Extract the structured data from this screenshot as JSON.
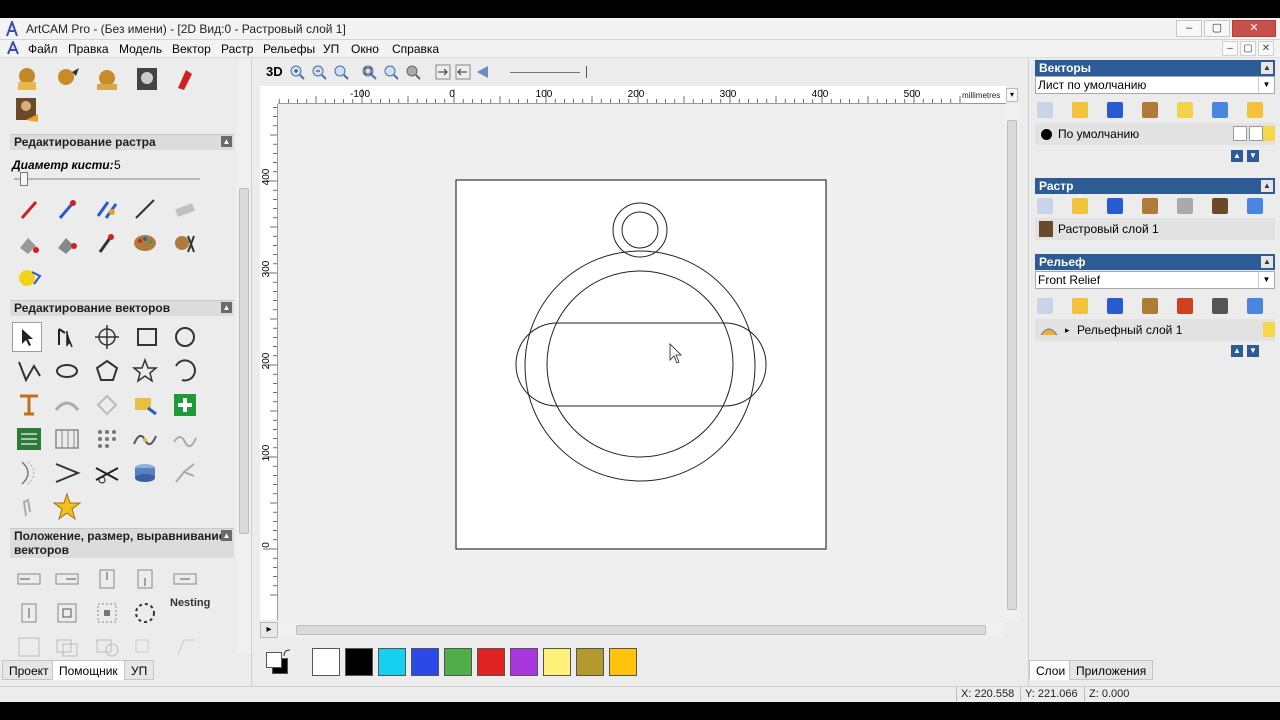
{
  "window": {
    "title": "ArtCAM Pro - (Без имени) - [2D Вид:0 - Растровый слой 1]",
    "buttons": [
      "–",
      "▢",
      "✕"
    ]
  },
  "menu": [
    "Файл",
    "Правка",
    "Модель",
    "Вектор",
    "Растр",
    "Рельефы",
    "УП",
    "Окно",
    "Справка"
  ],
  "left_panel": {
    "raster_section": "Редактирование растра",
    "brush_label": "Диаметр кисти:",
    "brush_value": "5",
    "vector_section": "Редактирование векторов",
    "transform_section": "Положение, размер, выравнивание векторов",
    "nesting_label": "Nesting",
    "tabs": [
      "Проект",
      "Помощник",
      "УП"
    ]
  },
  "toolbar2": {
    "view3d_label": "3D"
  },
  "ruler": {
    "units": "millimetres",
    "top_ticks": [
      "-100",
      "0",
      "100",
      "200",
      "300",
      "400",
      "500"
    ],
    "left_ticks": [
      "400",
      "300",
      "200",
      "100",
      "0"
    ]
  },
  "palette": {
    "colors": [
      "#ffffff",
      "#000000",
      "#16d0f0",
      "#2c48e6",
      "#4fae4a",
      "#e02222",
      "#a838de",
      "#fff07a",
      "#b39a2e",
      "#ffc30b"
    ]
  },
  "right_panel": {
    "vectors_header": "Векторы",
    "vectors_sheet": "Лист по умолчанию",
    "vectors_layer": "По умолчанию",
    "raster_header": "Растр",
    "raster_layer": "Растровый слой 1",
    "relief_header": "Рельеф",
    "relief_dropdown": "Front Relief",
    "relief_layer": "Рельефный слой 1",
    "tabs": [
      "Слои",
      "Приложения"
    ]
  },
  "status": {
    "x": "X: 220.558",
    "y": "Y: 221.066",
    "z": "Z: 0.000"
  }
}
